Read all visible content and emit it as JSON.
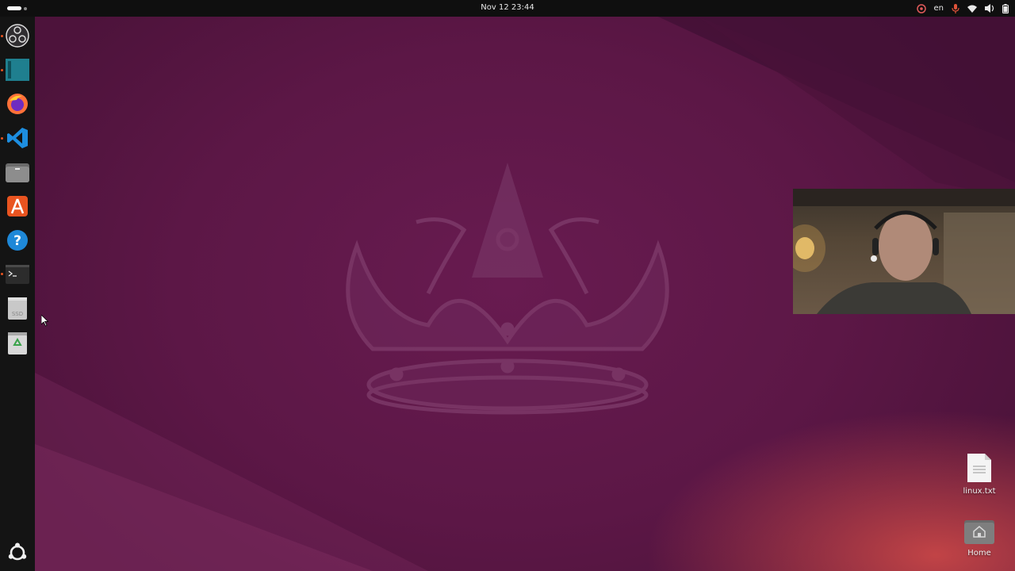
{
  "topbar": {
    "datetime": "Nov 12  23:44",
    "keyboard_layout": "en"
  },
  "dock": {
    "items": [
      {
        "name": "obs-studio"
      },
      {
        "name": "app-teal"
      },
      {
        "name": "firefox"
      },
      {
        "name": "vscode"
      },
      {
        "name": "files"
      },
      {
        "name": "app-center"
      },
      {
        "name": "help"
      },
      {
        "name": "terminal"
      },
      {
        "name": "ssd-drive",
        "label": "SSD"
      },
      {
        "name": "trash"
      },
      {
        "name": "show-apps"
      }
    ]
  },
  "desktop": {
    "icons": [
      {
        "label": "linux.txt"
      },
      {
        "label": "Home"
      }
    ]
  },
  "colors": {
    "accent": "#e95420",
    "wallpaper": "#5c1746",
    "panel": "#0f0f0f",
    "dock": "#141414"
  }
}
